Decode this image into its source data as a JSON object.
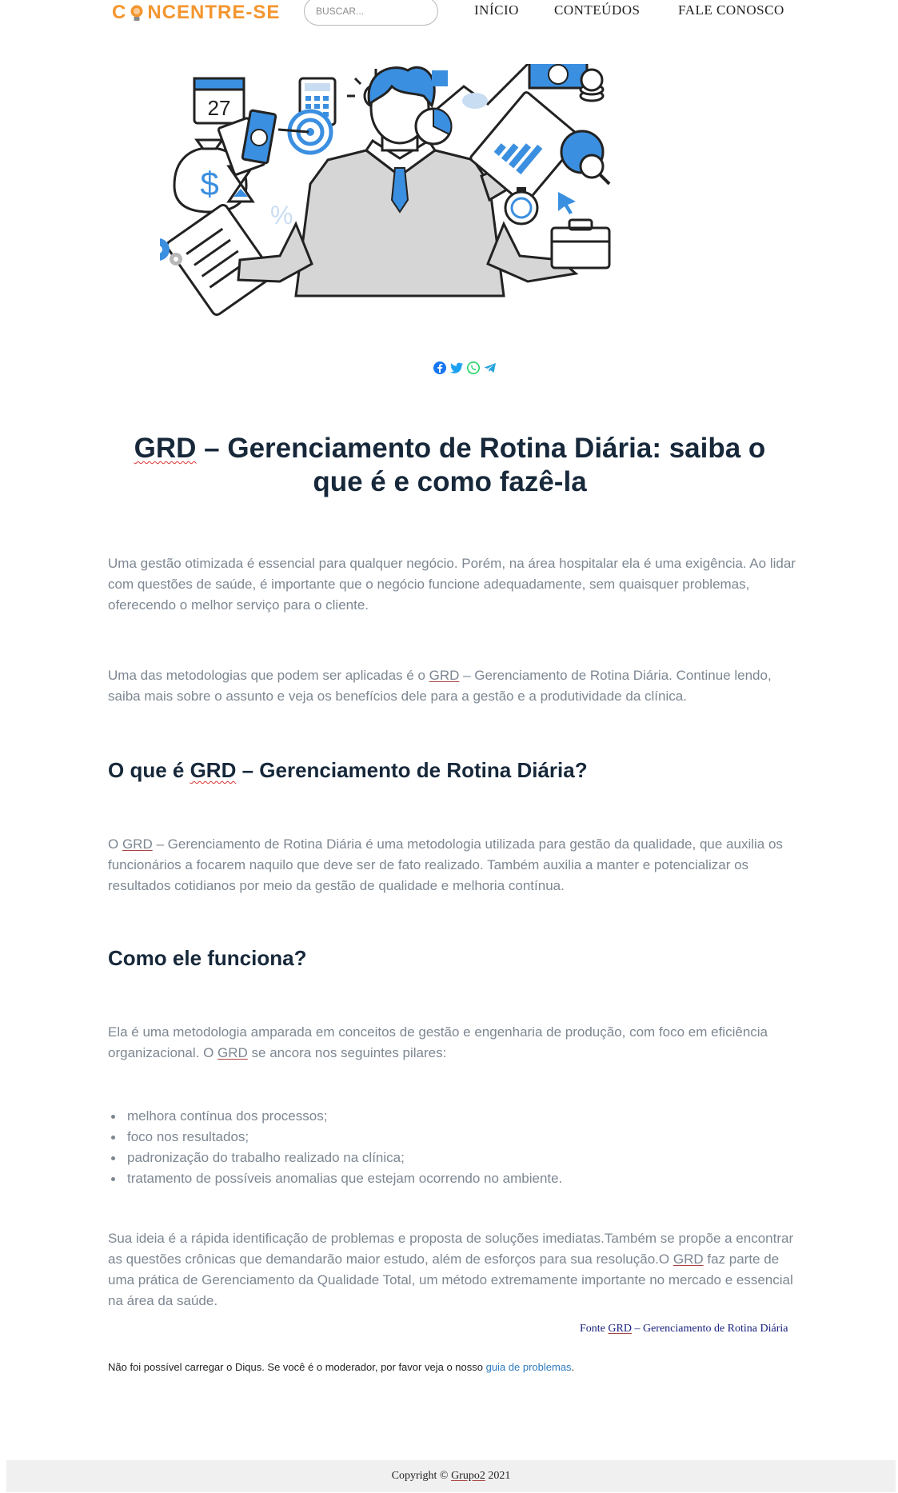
{
  "header": {
    "logo": {
      "prefix": "C",
      "suffix": "NCENTRE-SE"
    },
    "search_placeholder": "BUSCAR...",
    "nav": [
      "INÍCIO",
      "CONTEÚDOS",
      "FALE CONOSCO"
    ]
  },
  "share_icons": [
    "facebook-icon",
    "twitter-icon",
    "whatsapp-icon",
    "telegram-icon"
  ],
  "article": {
    "title_abbr": "GRD",
    "title_rest": " – Gerenciamento de Rotina Diária: saiba o que é e como fazê-la",
    "intro": "Uma gestão otimizada é essencial para qualquer negócio. Porém, na área hospitalar ela é uma exigência. Ao lidar com questões de saúde, é importante que o negócio funcione adequadamente, sem quaisquer problemas, oferecendo o melhor serviço para o cliente.",
    "p2_before": "Uma das metodologias que podem ser aplicadas é o ",
    "p2_abbr": "GRD",
    "p2_after": " – Gerenciamento de Rotina Diária. Continue lendo, saiba mais sobre o assunto e veja os benefícios dele para a gestão e a produtividade da clínica.",
    "h2_what_before": "O que é ",
    "h2_what_abbr": "GRD",
    "h2_what_after": " – Gerenciamento de Rotina Diária?",
    "p3_before": "O ",
    "p3_abbr": "GRD",
    "p3_after": " – Gerenciamento de Rotina Diária é uma metodologia utilizada para gestão da qualidade, que auxilia os funcionários a focarem naquilo que deve ser de fato realizado. Também auxilia a manter e potencializar os resultados cotidianos por meio da gestão de qualidade e melhoria contínua.",
    "h2_how": "Como ele funciona?",
    "p4_before": "Ela é uma metodologia amparada em conceitos de gestão e engenharia de produção, com foco em eficiência organizacional. O ",
    "p4_abbr": "GRD",
    "p4_after": " se ancora nos seguintes pilares:",
    "pillars": [
      "melhora contínua dos processos;",
      "foco nos resultados;",
      "padronização do trabalho realizado na clínica;",
      "tratamento de possíveis anomalias que estejam ocorrendo no ambiente."
    ],
    "p5_before": "Sua ideia é a rápida identificação de problemas e proposta de soluções imediatas.Também se propõe a encontrar as questões crônicas que demandarão maior estudo, além de esforços para sua resolução.O ",
    "p5_abbr": "GRD",
    "p5_after": " faz parte de uma prática de Gerenciamento da Qualidade Total, um método extremamente importante no mercado e essencial na área da saúde.",
    "source_before": "Fonte ",
    "source_abbr": "GRD",
    "source_after": " – Gerenciamento de Rotina Diária"
  },
  "disqus": {
    "message": "Não foi possível carregar o Diqus. Se você é o moderador, por favor veja o nosso ",
    "link": "guia de problemas",
    "end": "."
  },
  "footer": {
    "before": "Copyright © ",
    "company": "Grupo2",
    "after": " 2021"
  },
  "colors": {
    "brand": "#f4962f",
    "accent": "#3b8fe0",
    "heading": "#17283a",
    "body_text": "#7d8792",
    "link": "#2e7bbf"
  },
  "hero_illustration": {
    "calendar_day": "27",
    "percent": "%",
    "dollar": "$"
  }
}
